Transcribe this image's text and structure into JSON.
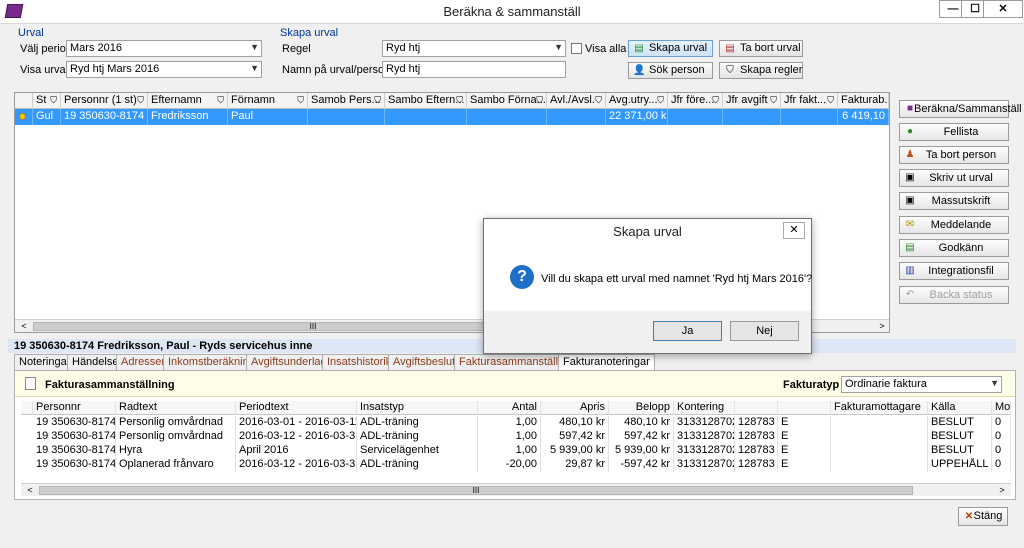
{
  "window": {
    "title": "Beräkna & sammanställ",
    "min": "—",
    "max": "☐",
    "close": "✕"
  },
  "urval": {
    "group_label": "Urval",
    "period_label": "Välj period",
    "period_value": "Mars 2016",
    "visa_label": "Visa urval",
    "visa_value": "Ryd htj  Mars 2016"
  },
  "skapa": {
    "group_label": "Skapa urval",
    "regel_label": "Regel",
    "regel_value": "Ryd htj",
    "visa_alla_label": "Visa alla",
    "namn_label": "Namn på urval/personnr",
    "namn_value": "Ryd htj"
  },
  "toolbar": {
    "skapa_urval": "Skapa urval",
    "ta_bort_urval": "Ta bort urval",
    "sok_person": "Sök person",
    "skapa_regler": "Skapa regler"
  },
  "grid": {
    "columns": [
      "St",
      "Personnr (1 st)",
      "Efternamn",
      "Förnamn",
      "Samob Pers...",
      "Sambo Eftern...",
      "Sambo Förna...",
      "Avl./Avsl.",
      "Avg.utry...",
      "Jfr före...",
      "Jfr avgift",
      "Jfr fakt...",
      "Fakturab..."
    ],
    "row": {
      "st": "Gul",
      "personnr": "19 350630-8174",
      "efternamn": "Fredriksson",
      "fornamn": "Paul",
      "avg": "22 371,00 kr",
      "faktura": "6 419,10"
    },
    "scroll_left": "<",
    "scroll_right": ">",
    "scroll_thumb": "III"
  },
  "side_buttons": {
    "berakna": "Beräkna/Sammanställ",
    "fellista": "Fellista",
    "ta_bort_person": "Ta bort person",
    "skriv_ut": "Skriv ut urval",
    "massutskrift": "Massutskrift",
    "meddelande": "Meddelande",
    "godkann": "Godkänn",
    "integrationsfil": "Integrationsfil",
    "backa_status": "Backa status"
  },
  "person_bar": "19 350630-8174 Fredriksson, Paul  -  Ryds servicehus inne",
  "tabs": [
    "Noteringar",
    "Händelser",
    "Adresser",
    "Inkomstberäkning",
    "Avgiftsunderlag",
    "Insatshistorik",
    "Avgiftsbeslut",
    "Fakturasammanställning",
    "Fakturanoteringar"
  ],
  "faktura": {
    "title": "Fakturasammanställning",
    "typ_label": "Fakturatyp",
    "typ_value": "Ordinarie faktura",
    "columns": [
      "Personnr",
      "Radtext",
      "Periodtext",
      "Insatstyp",
      "Antal",
      "Apris",
      "Belopp",
      "Kontering",
      "",
      "",
      "Fakturamottagare",
      "Källa",
      "Mo"
    ],
    "rows": [
      [
        "19 350630-8174",
        "Personlig omvårdnad",
        "2016-03-01 - 2016-03-11",
        "ADL-träning",
        "1,00",
        "480,10 kr",
        "480,10 kr",
        "3133128702",
        "128783",
        "E",
        "",
        "BESLUT",
        "0"
      ],
      [
        "19 350630-8174",
        "Personlig omvårdnad",
        "2016-03-12 - 2016-03-31",
        "ADL-träning",
        "1,00",
        "597,42 kr",
        "597,42 kr",
        "3133128702",
        "128783",
        "E",
        "",
        "BESLUT",
        "0"
      ],
      [
        "19 350630-8174",
        "Hyra",
        "April 2016",
        "Servicelägenhet",
        "1,00",
        "5 939,00 kr",
        "5 939,00 kr",
        "3133128702",
        "128783",
        "E",
        "",
        "BESLUT",
        "0"
      ],
      [
        "19 350630-8174",
        "Oplanerad frånvaro",
        "2016-03-12 - 2016-03-31",
        "ADL-träning",
        "-20,00",
        "29,87 kr",
        "-597,42 kr",
        "3133128702",
        "128783",
        "E",
        "",
        "UPPEHÅLL",
        "0"
      ]
    ]
  },
  "close_label": "Stäng",
  "dialog": {
    "title": "Skapa urval",
    "close": "✕",
    "icon": "?",
    "message": "Vill du skapa ett urval med namnet 'Ryd htj  Mars 2016'?",
    "yes": "Ja",
    "no": "Nej"
  },
  "colors": {
    "selection": "#3399ff",
    "accent": "#1e6fc7",
    "tab_text": "#8b3a1a"
  }
}
